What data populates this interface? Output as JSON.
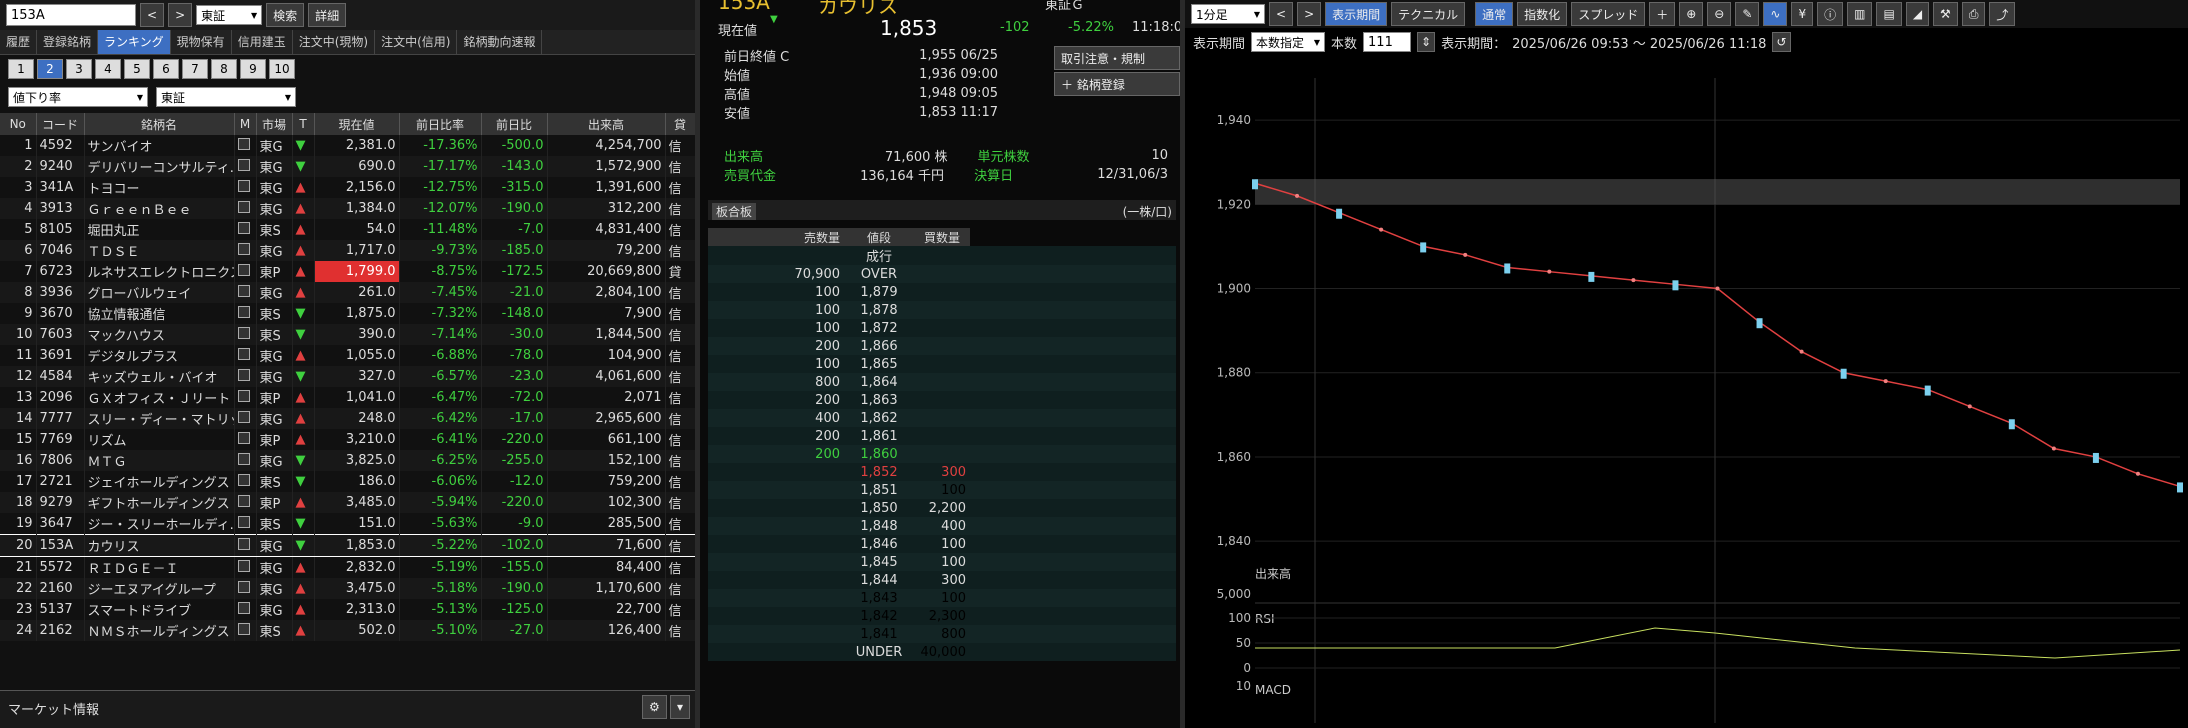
{
  "left": {
    "search": {
      "value": "153A",
      "market": "東証",
      "search_btn": "検索",
      "detail_btn": "詳細"
    },
    "tabs": [
      "履歴",
      "登録銘柄",
      "ランキング",
      "現物保有",
      "信用建玉",
      "注文中(現物)",
      "注文中(信用)",
      "銘柄動向速報"
    ],
    "pages": [
      "1",
      "2",
      "3",
      "4",
      "5",
      "6",
      "7",
      "8",
      "9",
      "10"
    ],
    "filter_type": "値下り率",
    "filter_market": "東証",
    "headers": [
      "No",
      "コード",
      "銘柄名",
      "M",
      "市場",
      "T",
      "現在値",
      "前日比率",
      "前日比",
      "出来高",
      "貸"
    ],
    "rows": [
      [
        "1",
        "4592",
        "サンバイオ",
        "東G",
        "▼",
        "2,381.0",
        "-17.36%",
        "-500.0",
        "4,254,700",
        "信"
      ],
      [
        "2",
        "9240",
        "デリバリーコンサルティ...",
        "東G",
        "▼",
        "690.0",
        "-17.17%",
        "-143.0",
        "1,572,900",
        "信"
      ],
      [
        "3",
        "341A",
        "トヨコー",
        "東G",
        "▲",
        "2,156.0",
        "-12.75%",
        "-315.0",
        "1,391,600",
        "信"
      ],
      [
        "4",
        "3913",
        "ＧｒｅｅｎＢｅｅ",
        "東G",
        "▲",
        "1,384.0",
        "-12.07%",
        "-190.0",
        "312,200",
        "信"
      ],
      [
        "5",
        "8105",
        "堀田丸正",
        "東S",
        "▲",
        "54.0",
        "-11.48%",
        "-7.0",
        "4,831,400",
        "信"
      ],
      [
        "6",
        "7046",
        "ＴＤＳＥ",
        "東G",
        "▲",
        "1,717.0",
        "-9.73%",
        "-185.0",
        "79,200",
        "信"
      ],
      [
        "7",
        "6723",
        "ルネサスエレクトロニクス",
        "東P",
        "▲",
        "1,799.0",
        "-8.75%",
        "-172.5",
        "20,669,800",
        "貸"
      ],
      [
        "8",
        "3936",
        "グローバルウェイ",
        "東G",
        "▲",
        "261.0",
        "-7.45%",
        "-21.0",
        "2,804,100",
        "信"
      ],
      [
        "9",
        "3670",
        "協立情報通信",
        "東S",
        "▼",
        "1,875.0",
        "-7.32%",
        "-148.0",
        "7,900",
        "信"
      ],
      [
        "10",
        "7603",
        "マックハウス",
        "東S",
        "▼",
        "390.0",
        "-7.14%",
        "-30.0",
        "1,844,500",
        "信"
      ],
      [
        "11",
        "3691",
        "デジタルプラス",
        "東G",
        "▲",
        "1,055.0",
        "-6.88%",
        "-78.0",
        "104,900",
        "信"
      ],
      [
        "12",
        "4584",
        "キッズウェル・バイオ",
        "東G",
        "▼",
        "327.0",
        "-6.57%",
        "-23.0",
        "4,061,600",
        "信"
      ],
      [
        "13",
        "2096",
        "ＧＸオフィス・Ｊリート",
        "東P",
        "▲",
        "1,041.0",
        "-6.47%",
        "-72.0",
        "2,071",
        "信"
      ],
      [
        "14",
        "7777",
        "スリー・ディー・マトリッ...",
        "東G",
        "▲",
        "248.0",
        "-6.42%",
        "-17.0",
        "2,965,600",
        "信"
      ],
      [
        "15",
        "7769",
        "リズム",
        "東P",
        "▲",
        "3,210.0",
        "-6.41%",
        "-220.0",
        "661,100",
        "信"
      ],
      [
        "16",
        "7806",
        "ＭＴＧ",
        "東G",
        "▼",
        "3,825.0",
        "-6.25%",
        "-255.0",
        "152,100",
        "信"
      ],
      [
        "17",
        "2721",
        "ジェイホールディングス",
        "東S",
        "▼",
        "186.0",
        "-6.06%",
        "-12.0",
        "759,200",
        "信"
      ],
      [
        "18",
        "9279",
        "ギフトホールディングス",
        "東P",
        "▲",
        "3,485.0",
        "-5.94%",
        "-220.0",
        "102,300",
        "信"
      ],
      [
        "19",
        "3647",
        "ジー・スリーホールディ...",
        "東S",
        "▼",
        "151.0",
        "-5.63%",
        "-9.0",
        "285,500",
        "信"
      ],
      [
        "20",
        "153A",
        "カウリス",
        "東G",
        "▼",
        "1,853.0",
        "-5.22%",
        "-102.0",
        "71,600",
        "信"
      ],
      [
        "21",
        "5572",
        "ＲＩＤＧＥ－Ｉ",
        "東G",
        "▲",
        "2,832.0",
        "-5.19%",
        "-155.0",
        "84,400",
        "信"
      ],
      [
        "22",
        "2160",
        "ジーエヌアイグループ",
        "東G",
        "▲",
        "3,475.0",
        "-5.18%",
        "-190.0",
        "1,170,600",
        "信"
      ],
      [
        "23",
        "5137",
        "スマートドライブ",
        "東G",
        "▲",
        "2,313.0",
        "-5.13%",
        "-125.0",
        "22,700",
        "信"
      ],
      [
        "24",
        "2162",
        "ＮＭＳホールディングス",
        "東S",
        "▲",
        "502.0",
        "-5.10%",
        "-27.0",
        "126,400",
        "信"
      ]
    ],
    "market_info": "マーケット情報"
  },
  "mid": {
    "code": "153A",
    "name": "カウリス",
    "market": "東証Ｇ",
    "now_label": "現在値",
    "now": "1,853",
    "change": "-102",
    "change_pct": "-5.22%",
    "time": "11:18:0",
    "prev_label": "前日終値",
    "prev_flag": "C",
    "prev": "1,955",
    "prev_date": "06/25",
    "open_label": "始値",
    "open": "1,936",
    "open_time": "09:00",
    "high_label": "高値",
    "high": "1,948",
    "high_time": "09:05",
    "low_label": "安値",
    "low": "1,853",
    "low_time": "11:17",
    "btn_order": "取引注意・規制",
    "btn_reg": "銘柄登録",
    "vol_label": "出来高",
    "vol": "71,600",
    "vol_unit": "株",
    "unit_label": "単元株数",
    "unit": "10",
    "amt_label": "売買代金",
    "amt": "136,164",
    "amt_unit": "千円",
    "settle_label": "決算日",
    "settle": "12/31,06/3",
    "board_title": "板合板",
    "board_unit": "(一株/口)",
    "board_headers": [
      "売数量",
      "値段",
      "買数量"
    ],
    "board": [
      [
        "",
        "成行",
        ""
      ],
      [
        "70,900",
        "OVER",
        ""
      ],
      [
        "100",
        "1,879",
        ""
      ],
      [
        "100",
        "1,878",
        ""
      ],
      [
        "100",
        "1,872",
        ""
      ],
      [
        "200",
        "1,866",
        ""
      ],
      [
        "100",
        "1,865",
        ""
      ],
      [
        "800",
        "1,864",
        ""
      ],
      [
        "200",
        "1,863",
        ""
      ],
      [
        "400",
        "1,862",
        ""
      ],
      [
        "200",
        "1,861",
        ""
      ],
      [
        "200",
        "1,860",
        ""
      ],
      [
        "",
        "1,852",
        "300"
      ],
      [
        "",
        "1,851",
        "100"
      ],
      [
        "",
        "1,850",
        "2,200"
      ],
      [
        "",
        "1,848",
        "400"
      ],
      [
        "",
        "1,846",
        "100"
      ],
      [
        "",
        "1,845",
        "100"
      ],
      [
        "",
        "1,844",
        "300"
      ],
      [
        "",
        "1,843",
        "100"
      ],
      [
        "",
        "1,842",
        "2,300"
      ],
      [
        "",
        "1,841",
        "800"
      ],
      [
        "",
        "UNDER",
        "40,000"
      ]
    ]
  },
  "chart": {
    "interval": "1分足",
    "btns": [
      "表示期間",
      "テクニカル",
      "通常",
      "指数化",
      "スプレッド"
    ],
    "period_label": "表示期間",
    "period_mode": "本数指定",
    "count_label": "本数",
    "count": "111",
    "range_label": "表示期間：",
    "range": "2025/06/26 09:53 〜 2025/06/26 11:18",
    "yticks": [
      "1,940",
      "1,920",
      "1,900",
      "1,880",
      "1,860",
      "1,840"
    ],
    "vol_label": "出来高",
    "vol_tick": "5,000",
    "rsi_label": "RSI",
    "rsi_ticks": [
      "100",
      "50",
      "0"
    ],
    "macd_label": "MACD",
    "macd_tick": "10"
  },
  "chart_data": {
    "type": "line",
    "title": "",
    "ylim": [
      1836,
      1950
    ],
    "x": [
      0,
      5,
      10,
      15,
      20,
      25,
      30,
      35,
      40,
      45,
      50,
      55,
      60,
      65,
      70,
      75,
      80,
      85,
      90,
      95,
      100,
      105,
      110
    ],
    "series": [
      {
        "values": [
          1925,
          1922,
          1918,
          1914,
          1910,
          1908,
          1905,
          1904,
          1903,
          1902,
          1901,
          1900,
          1892,
          1885,
          1880,
          1878,
          1876,
          1872,
          1868,
          1862,
          1860,
          1856,
          1853
        ]
      }
    ]
  },
  "colors": {
    "accent": "#3d6fc2",
    "up": "#e04040",
    "down": "#3fd03f"
  }
}
